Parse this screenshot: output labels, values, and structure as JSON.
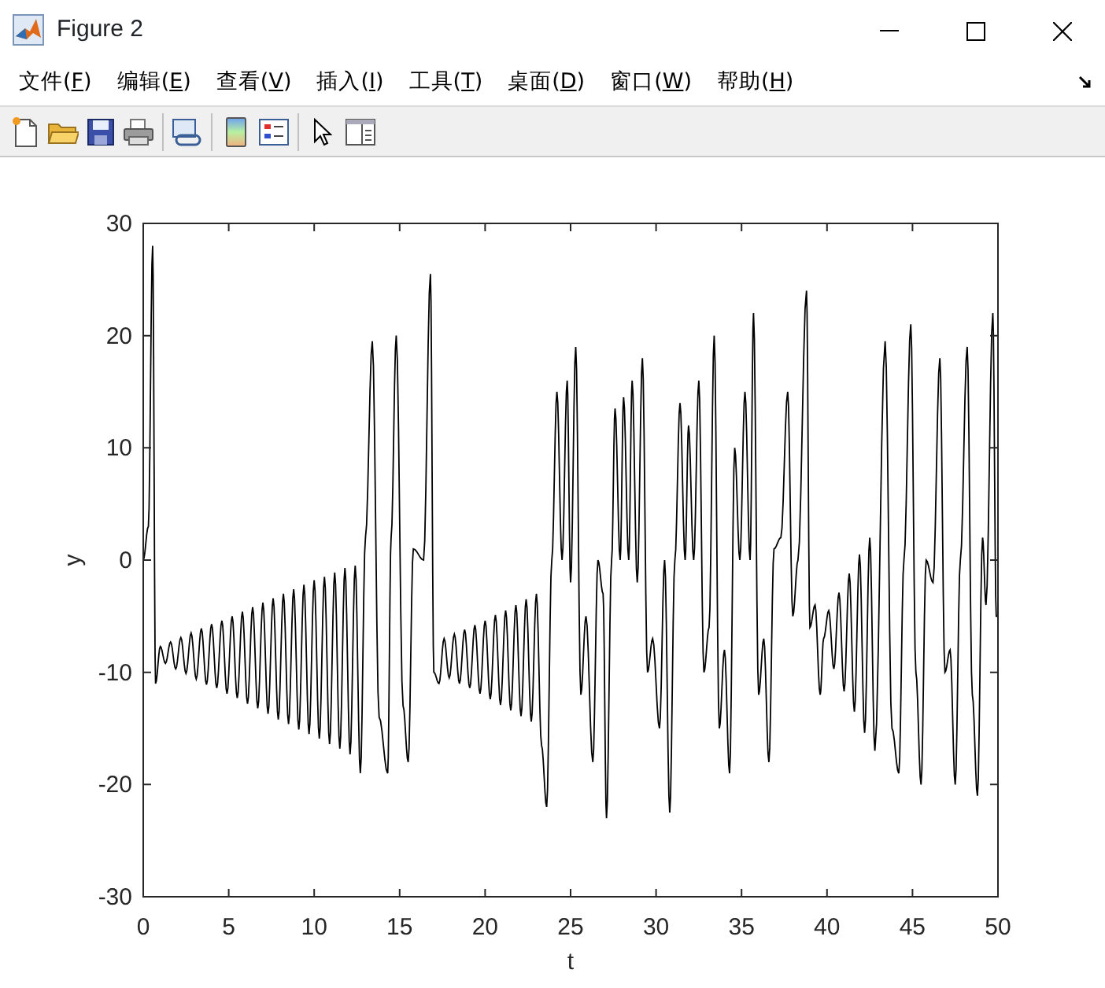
{
  "window": {
    "title": "Figure 2"
  },
  "menu": [
    {
      "text": "文件(",
      "key": "F",
      "tail": ")"
    },
    {
      "text": "编辑(",
      "key": "E",
      "tail": ")"
    },
    {
      "text": "查看(",
      "key": "V",
      "tail": ")"
    },
    {
      "text": "插入(",
      "key": "I",
      "tail": ")"
    },
    {
      "text": "工具(",
      "key": "T",
      "tail": ")"
    },
    {
      "text": "桌面(",
      "key": "D",
      "tail": ")"
    },
    {
      "text": "窗口(",
      "key": "W",
      "tail": ")"
    },
    {
      "text": "帮助(",
      "key": "H",
      "tail": ")"
    }
  ],
  "plot": {
    "chart_data": {
      "type": "line",
      "xlabel": "t",
      "ylabel": "y",
      "xlim": [
        0,
        50
      ],
      "ylim": [
        -30,
        30
      ],
      "xticks": [
        0,
        5,
        10,
        15,
        20,
        25,
        30,
        35,
        40,
        45,
        50
      ],
      "yticks": [
        -30,
        -20,
        -10,
        0,
        10,
        20,
        30
      ],
      "x": [
        0,
        0.3,
        0.55,
        0.72,
        1.0,
        1.3,
        1.6,
        1.9,
        2.2,
        2.5,
        2.8,
        3.1,
        3.4,
        3.7,
        4.0,
        4.3,
        4.6,
        4.9,
        5.2,
        5.5,
        5.8,
        6.1,
        6.4,
        6.7,
        7.0,
        7.3,
        7.6,
        7.9,
        8.2,
        8.5,
        8.8,
        9.1,
        9.4,
        9.7,
        10.0,
        10.3,
        10.6,
        10.9,
        11.2,
        11.5,
        11.8,
        12.1,
        12.4,
        12.7,
        13.0,
        13.4,
        13.8,
        14.3,
        14.5,
        14.8,
        15.2,
        15.5,
        15.8,
        16.4,
        16.8,
        17.0,
        17.3,
        17.6,
        17.9,
        18.2,
        18.5,
        18.8,
        19.1,
        19.4,
        19.7,
        20.0,
        20.3,
        20.6,
        20.9,
        21.2,
        21.5,
        21.8,
        22.1,
        22.4,
        22.7,
        23.0,
        23.3,
        23.6,
        23.9,
        24.2,
        24.5,
        24.8,
        25.0,
        25.3,
        25.6,
        25.9,
        26.3,
        26.6,
        26.9,
        27.1,
        27.4,
        27.6,
        27.9,
        28.1,
        28.4,
        28.6,
        28.9,
        29.2,
        29.5,
        29.8,
        30.2,
        30.5,
        30.8,
        31.1,
        31.4,
        31.7,
        31.9,
        32.2,
        32.5,
        32.8,
        33.1,
        33.4,
        33.7,
        34.0,
        34.3,
        34.6,
        34.9,
        35.2,
        35.5,
        35.7,
        36.0,
        36.3,
        36.6,
        36.9,
        37.3,
        37.7,
        38.0,
        38.3,
        38.8,
        39.0,
        39.3,
        39.6,
        39.8,
        40.1,
        40.4,
        40.7,
        41.0,
        41.3,
        41.6,
        41.9,
        42.2,
        42.5,
        42.8,
        43.4,
        43.8,
        44.2,
        44.5,
        44.9,
        45.2,
        45.5,
        45.8,
        46.2,
        46.6,
        46.9,
        47.2,
        47.5,
        47.8,
        48.2,
        48.5,
        48.8,
        49.1,
        49.3,
        49.7,
        49.9,
        50
      ],
      "series": [
        {
          "color": "#000000",
          "values": [
            0,
            3,
            28,
            -11,
            -7.7,
            -9.2,
            -7.3,
            -9.7,
            -6.9,
            -10.1,
            -6.5,
            -10.6,
            -6.1,
            -11.1,
            -5.7,
            -11.4,
            -5.4,
            -11.9,
            -5.0,
            -12.3,
            -4.6,
            -12.8,
            -4.2,
            -13.2,
            -3.8,
            -13.7,
            -3.4,
            -14.2,
            -3.0,
            -14.6,
            -2.6,
            -15.1,
            -2.2,
            -15.5,
            -1.8,
            -15.9,
            -1.5,
            -16.4,
            -1.1,
            -16.8,
            -0.7,
            -17.3,
            -0.5,
            -19,
            2,
            19.5,
            -14,
            -19,
            2,
            20,
            -13,
            -18,
            1,
            0,
            25.5,
            -10,
            -11,
            -7,
            -10.5,
            -6.6,
            -11.0,
            -6.2,
            -11.4,
            -5.8,
            -11.9,
            -5.4,
            -12.4,
            -4.9,
            -12.9,
            -4.5,
            -13.4,
            -4.0,
            -13.9,
            -3.5,
            -14.4,
            -3.0,
            -16.5,
            -22,
            0,
            15,
            0,
            16,
            -2,
            19,
            -12,
            -5,
            -18,
            0,
            -3,
            -23,
            0,
            13.5,
            0,
            14.5,
            0,
            16,
            -2,
            18,
            -10,
            -7,
            -15,
            0,
            -22.5,
            0,
            14,
            0,
            12,
            0,
            16,
            -10,
            -6,
            20,
            -15,
            -8,
            -19,
            10,
            0,
            15,
            0,
            22,
            -12,
            -7,
            -18,
            1,
            2,
            15,
            -5,
            0,
            24,
            -6,
            -4,
            -12,
            -7,
            -4.5,
            -9.7,
            -2.9,
            -11.7,
            -1.2,
            -13.5,
            0.5,
            -15.4,
            2,
            -17,
            19.5,
            -15,
            -19,
            0,
            21,
            -10,
            -20,
            0,
            -2,
            18,
            -10,
            -8,
            -20,
            0,
            19,
            -12,
            -21,
            2,
            -4,
            22,
            -5,
            -5
          ]
        }
      ]
    }
  }
}
